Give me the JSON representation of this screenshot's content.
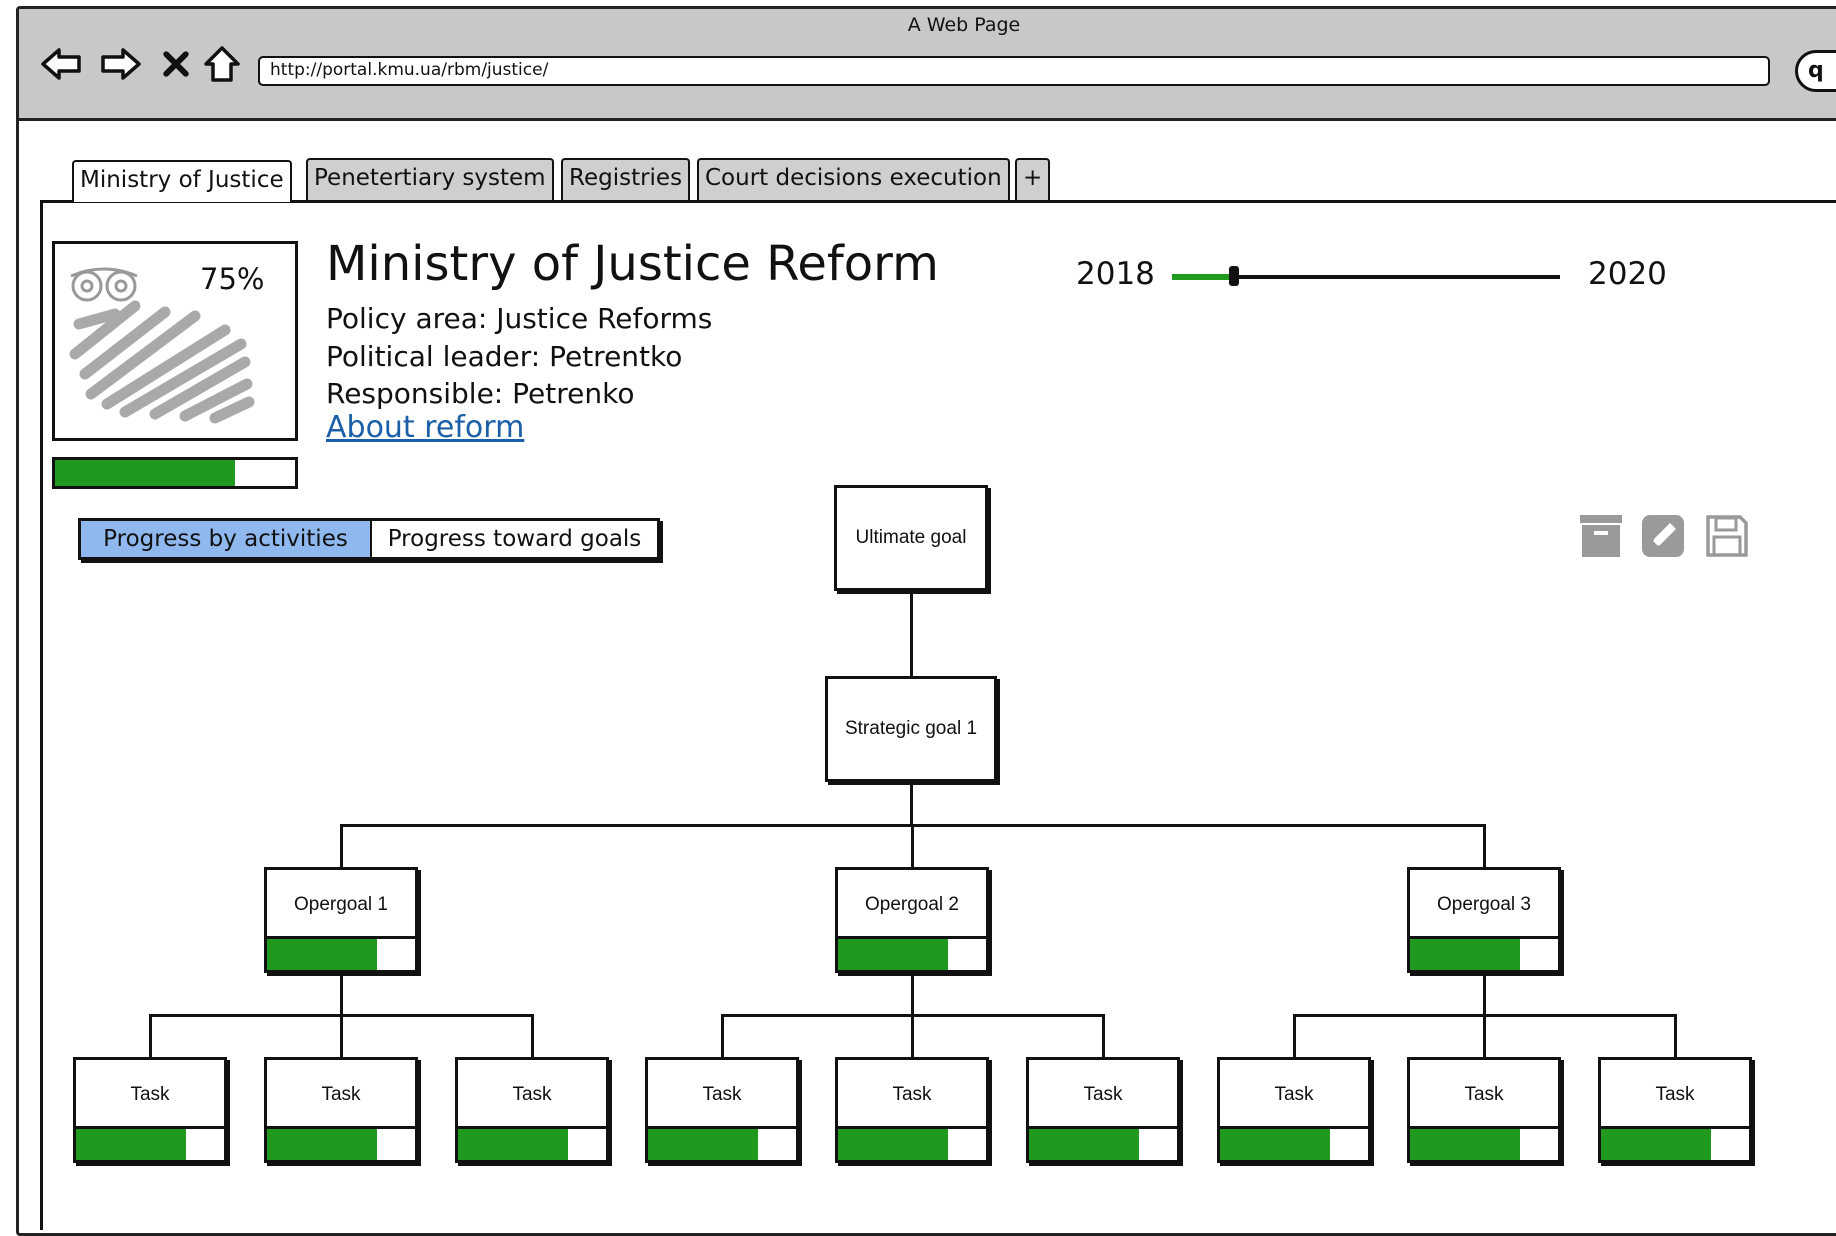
{
  "window": {
    "title": "A Web Page",
    "url": "http://portal.kmu.ua/rbm/justice/"
  },
  "tabs": [
    {
      "label": "Ministry of Justice",
      "active": true
    },
    {
      "label": "Penetertiary system",
      "active": false
    },
    {
      "label": "Registries",
      "active": false
    },
    {
      "label": "Court decisions execution",
      "active": false
    },
    {
      "label": "+",
      "active": false
    }
  ],
  "summary": {
    "progress_label": "75%",
    "progress": 0.75
  },
  "reform": {
    "title": "Ministry of Justice Reform",
    "policy_area": "Policy area: Justice Reforms",
    "political_leader": "Political leader: Petrentko",
    "responsible": "Responsible: Petrenko",
    "about_link": "About reform"
  },
  "timeline": {
    "start": "2018",
    "end": "2020",
    "position": 0.16
  },
  "view_toggle": {
    "options": [
      "Progress by activities",
      "Progress toward goals"
    ],
    "selected": 0
  },
  "toolbar": {
    "icons": [
      "archive-icon",
      "edit-icon",
      "save-icon"
    ]
  },
  "tree": {
    "ultimate": "Ultimate goal",
    "strategic": "Strategic goal 1",
    "opergoals": [
      {
        "label": "Opergoal 1",
        "progress": 0.74
      },
      {
        "label": "Opergoal 2",
        "progress": 0.74
      },
      {
        "label": "Opergoal 3",
        "progress": 0.74
      }
    ],
    "tasks": [
      {
        "label": "Task",
        "progress": 0.74
      },
      {
        "label": "Task",
        "progress": 0.74
      },
      {
        "label": "Task",
        "progress": 0.74
      },
      {
        "label": "Task",
        "progress": 0.74
      },
      {
        "label": "Task",
        "progress": 0.74
      },
      {
        "label": "Task",
        "progress": 0.74
      },
      {
        "label": "Task",
        "progress": 0.74
      },
      {
        "label": "Task",
        "progress": 0.74
      },
      {
        "label": "Task",
        "progress": 0.74
      }
    ]
  },
  "colors": {
    "progress": "#1f9a1f",
    "selected": "#8fb8ef",
    "link": "#1a5fa8",
    "chrome": "#c8c8c8"
  }
}
